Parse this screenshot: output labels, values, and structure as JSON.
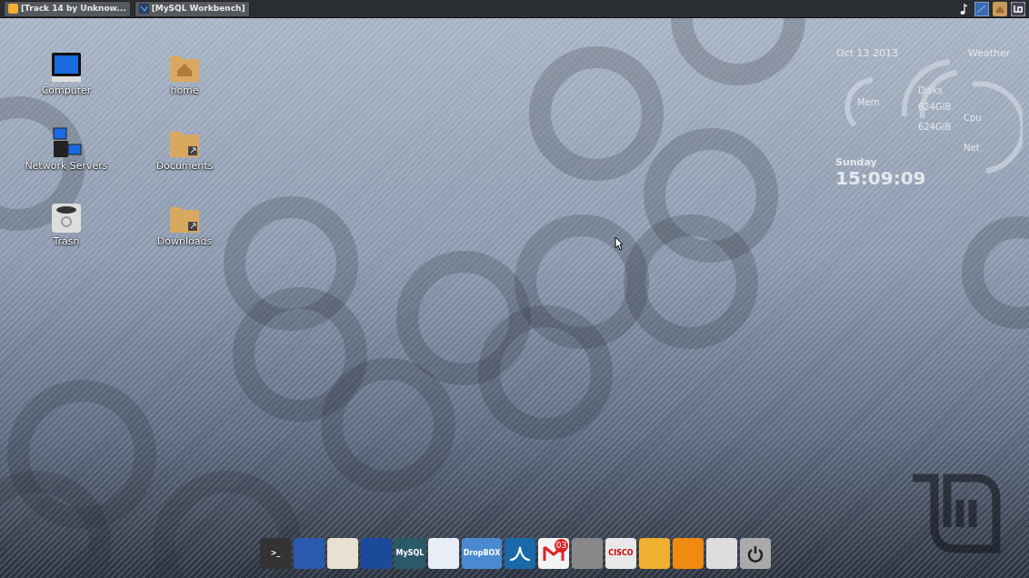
{
  "taskbar": {
    "windows": [
      {
        "title": "[Track 14 by Unknow...",
        "kind": "player"
      },
      {
        "title": "[MySQL Workbench]",
        "kind": "workbench"
      }
    ]
  },
  "desktop_icons": [
    {
      "label": "Computer",
      "kind": "computer"
    },
    {
      "label": "home",
      "kind": "home"
    },
    {
      "label": "Network Servers",
      "kind": "network"
    },
    {
      "label": "Documents",
      "kind": "folder-link"
    },
    {
      "label": "Trash",
      "kind": "trash"
    },
    {
      "label": "Downloads",
      "kind": "folder-link"
    }
  ],
  "widget": {
    "date": "Oct 13 2013",
    "weather": "Weather",
    "mem": "Mem",
    "disks": "Disks",
    "disk_sizes": [
      "624GiB",
      "624GiB"
    ],
    "cpu": "Cpu",
    "net": "Net",
    "day": "Sunday",
    "time": "15:09:09"
  },
  "dock": [
    {
      "kind": "terminal",
      "label": ">_"
    },
    {
      "kind": "firefox"
    },
    {
      "kind": "mail"
    },
    {
      "kind": "waves"
    },
    {
      "kind": "mysql",
      "label": "MySQL"
    },
    {
      "kind": "writer"
    },
    {
      "kind": "dropbox",
      "label": "DropBOX"
    },
    {
      "kind": "wireshark"
    },
    {
      "kind": "gmail",
      "badge": "03"
    },
    {
      "kind": "transfer"
    },
    {
      "kind": "cisco",
      "label": "CISCO"
    },
    {
      "kind": "b-app"
    },
    {
      "kind": "orange"
    },
    {
      "kind": "binary"
    },
    {
      "kind": "power"
    }
  ]
}
